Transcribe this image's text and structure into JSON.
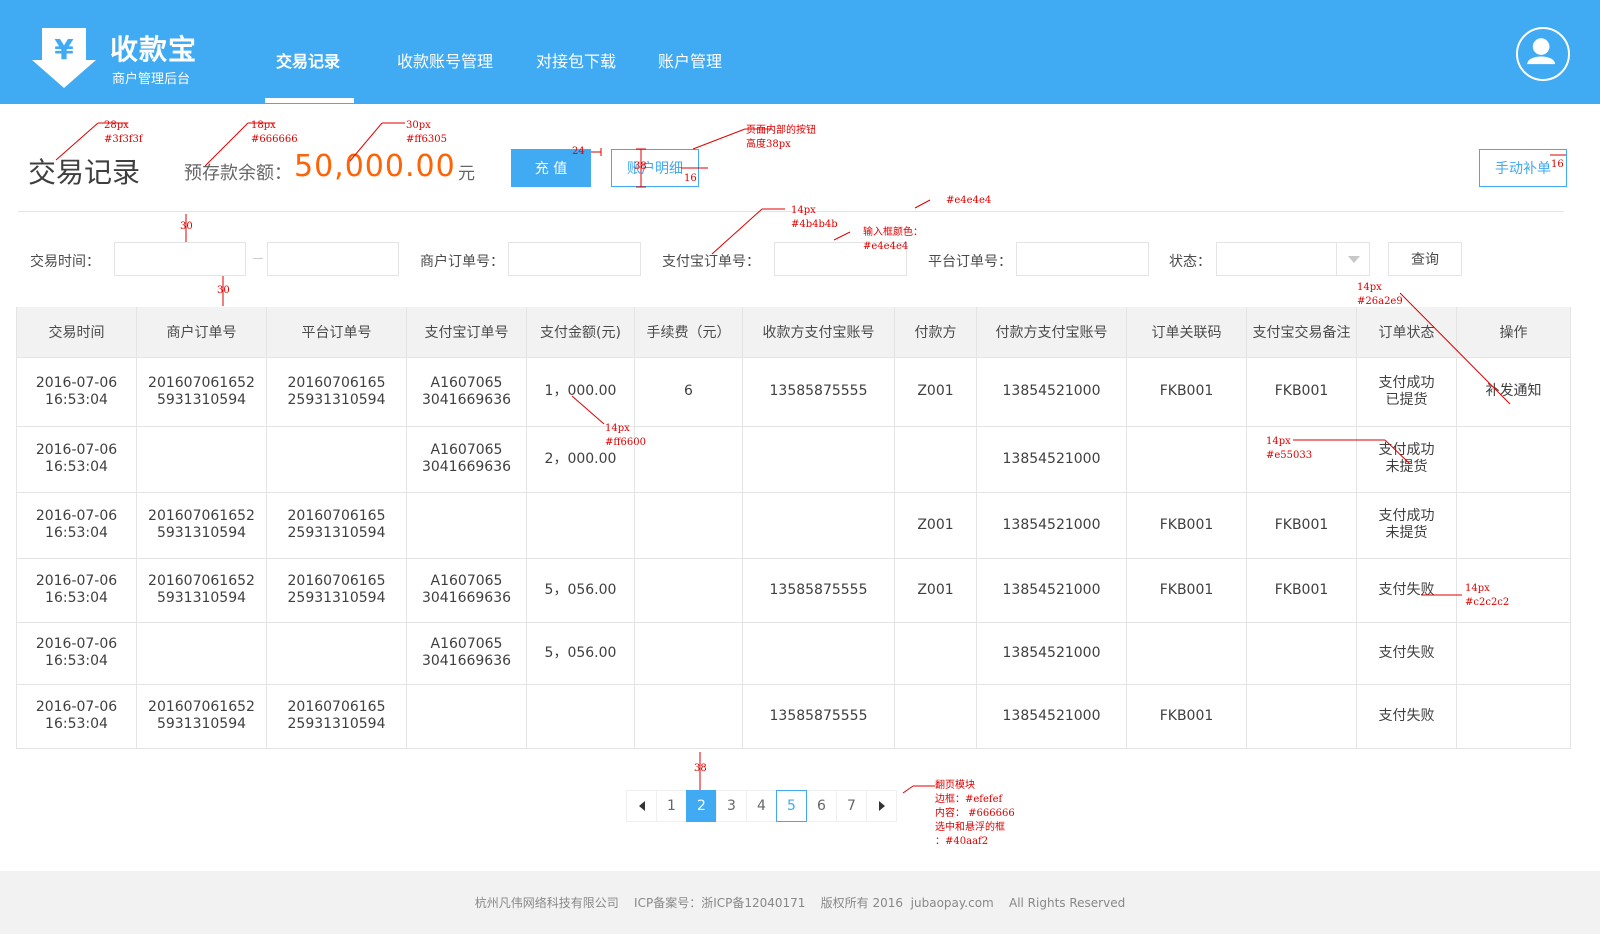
{
  "header": {
    "brand": "收款宝",
    "subtitle": "商户管理后台",
    "nav": [
      "交易记录",
      "收款账号管理",
      "对接包下载",
      "账户管理"
    ]
  },
  "title_row": {
    "page_title": "交易记录",
    "balance_label": "预存款余额：",
    "balance_value": "50,000.00",
    "balance_unit": "元",
    "recharge": "充 值",
    "detail": "账户明细",
    "manual": "手动补单"
  },
  "filters": {
    "time_label": "交易时间：",
    "merchant_label": "商户订单号：",
    "alipay_label": "支付宝订单号：",
    "platform_label": "平台订单号：",
    "status_label": "状态：",
    "query": "查询"
  },
  "table": {
    "headers": [
      "交易时间",
      "商户订单号",
      "平台订单号",
      "支付宝订单号",
      "支付金额(元)",
      "手续费（元）",
      "收款方支付宝账号",
      "付款方",
      "付款方支付宝账号",
      "订单关联码",
      "支付宝交易备注",
      "订单状态",
      "操作"
    ],
    "rows": [
      {
        "time": "2016-07-06\n16:53:04",
        "merchant": "201607061652\n5931310594",
        "platform": "20160706165\n25931310594",
        "alipay": "A1607065\n3041669636",
        "amount": "1，000.00",
        "fee": "6",
        "payee": "13585875555",
        "payer": "Z001",
        "payer_acct": "13854521000",
        "code": "FKB001",
        "remark": "FKB001",
        "status": "支付成功\n已提货",
        "action": "补发通知"
      },
      {
        "time": "2016-07-06\n16:53:04",
        "merchant": "",
        "platform": "",
        "alipay": "A1607065\n3041669636",
        "amount": "2，000.00",
        "fee": "",
        "payee": "",
        "payer": "",
        "payer_acct": "13854521000",
        "code": "",
        "remark": "",
        "status": "支付成功\n未提货",
        "action": ""
      },
      {
        "time": "2016-07-06\n16:53:04",
        "merchant": "201607061652\n5931310594",
        "platform": "20160706165\n25931310594",
        "alipay": "",
        "amount": "",
        "fee": "",
        "payee": "",
        "payer": "Z001",
        "payer_acct": "13854521000",
        "code": "FKB001",
        "remark": "FKB001",
        "status": "支付成功\n未提货",
        "action": ""
      },
      {
        "time": "2016-07-06\n16:53:04",
        "merchant": "201607061652\n5931310594",
        "platform": "20160706165\n25931310594",
        "alipay": "A1607065\n3041669636",
        "amount": "5，056.00",
        "fee": "",
        "payee": "13585875555",
        "payer": "Z001",
        "payer_acct": "13854521000",
        "code": "FKB001",
        "remark": "FKB001",
        "status": "支付失败",
        "action": ""
      },
      {
        "time": "2016-07-06\n16:53:04",
        "merchant": "",
        "platform": "",
        "alipay": "A1607065\n3041669636",
        "amount": "5，056.00",
        "fee": "",
        "payee": "",
        "payer": "",
        "payer_acct": "13854521000",
        "code": "",
        "remark": "",
        "status": "支付失败",
        "action": ""
      },
      {
        "time": "2016-07-06\n16:53:04",
        "merchant": "201607061652\n5931310594",
        "platform": "20160706165\n25931310594",
        "alipay": "",
        "amount": "",
        "fee": "",
        "payee": "13585875555",
        "payer": "",
        "payer_acct": "13854521000",
        "code": "FKB001",
        "remark": "",
        "status": "支付失败",
        "action": ""
      }
    ]
  },
  "pagination": {
    "pages": [
      "1",
      "2",
      "3",
      "4",
      "5",
      "6",
      "7"
    ],
    "current": "2",
    "hover": "5"
  },
  "footer": "杭州凡伟网络科技有限公司    ICP备案号：浙ICP备12040171    版权所有 2016  jubaopay.com    All Rights Reserved",
  "annotations": {
    "a_title": "28px\n#3f3f3f",
    "a_label": "18px\n#666666",
    "a_value": "30px\n#ff6305",
    "a_24": "24",
    "a_38": "38",
    "a_16": "16",
    "a_btn": "页面内部的按钮\n高度38px",
    "a_16b": "16",
    "a_gap1": "30",
    "a_gap2": "30",
    "a_14": "14px\n#4b4b4b",
    "a_input": "输入框颜色：\n#e4e4e4",
    "a_line": "#e4e4e4",
    "a_link": "14px\n#26a2e9",
    "a_amount": "14px\n#ff6600",
    "a_warn": "14px\n#e55033",
    "a_fail": "14px\n#c2c2c2",
    "a_gap3": "38",
    "a_pager": "翻页模块\n边框：#efefef\n内容： #666666\n选中和悬浮的框\n：#40aaf2"
  },
  "colors": {
    "brand": "#40aaf2",
    "amount": "#ff6600",
    "balance": "#ff6305",
    "warn": "#e55033",
    "fail": "#c2c2c2",
    "link": "#26a2e9"
  }
}
